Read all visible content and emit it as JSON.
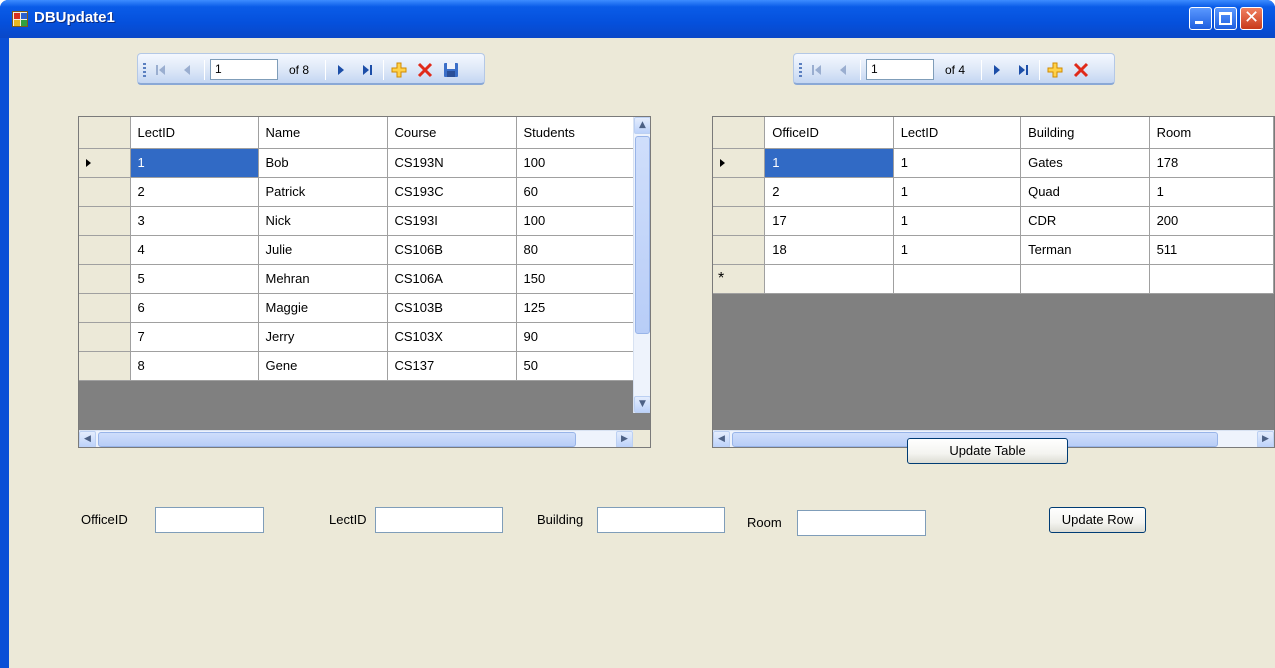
{
  "window": {
    "title": "DBUpdate1"
  },
  "left_navigator": {
    "position": "1",
    "of_text": "of 8"
  },
  "right_navigator": {
    "position": "1",
    "of_text": "of 4"
  },
  "lecturers_grid": {
    "columns": [
      "LectID",
      "Name",
      "Course",
      "Students"
    ],
    "rows": [
      [
        "1",
        "Bob",
        "CS193N",
        "100"
      ],
      [
        "2",
        "Patrick",
        "CS193C",
        "60"
      ],
      [
        "3",
        "Nick",
        "CS193I",
        "100"
      ],
      [
        "4",
        "Julie",
        "CS106B",
        "80"
      ],
      [
        "5",
        "Mehran",
        "CS106A",
        "150"
      ],
      [
        "6",
        "Maggie",
        "CS103B",
        "125"
      ],
      [
        "7",
        "Jerry",
        "CS103X",
        "90"
      ],
      [
        "8",
        "Gene",
        "CS137",
        "50"
      ]
    ],
    "selected_row": 0
  },
  "offices_grid": {
    "columns": [
      "OfficeID",
      "LectID",
      "Building",
      "Room"
    ],
    "rows": [
      [
        "1",
        "1",
        "Gates",
        "178"
      ],
      [
        "2",
        "1",
        "Quad",
        "1"
      ],
      [
        "17",
        "1",
        "CDR",
        "200"
      ],
      [
        "18",
        "1",
        "Terman",
        "511"
      ]
    ],
    "new_row_marker": "*",
    "selected_row": 0
  },
  "buttons": {
    "update_table": "Update Table",
    "update_row": "Update Row"
  },
  "form": {
    "office_label": "OfficeID",
    "office_value": "",
    "lect_label": "LectID",
    "lect_value": "",
    "building_label": "Building",
    "building_value": "",
    "room_label": "Room",
    "room_value": ""
  },
  "colors": {
    "selection": "#316ac5",
    "title_bar": "#0550dc",
    "client_bg": "#ece9d8"
  },
  "icons": [
    "first-record-icon",
    "previous-record-icon",
    "next-record-icon",
    "last-record-icon",
    "add-new-icon",
    "delete-icon",
    "save-icon"
  ]
}
